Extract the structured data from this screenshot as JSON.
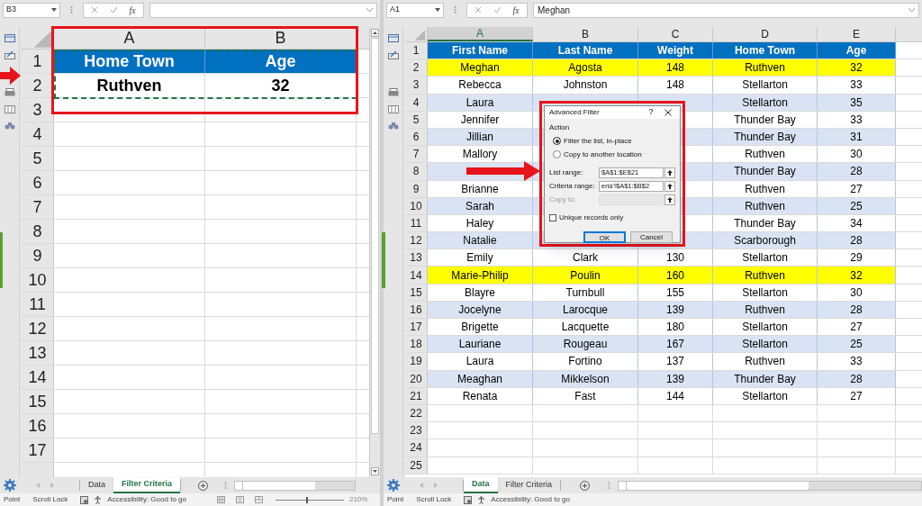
{
  "left_pane": {
    "name_box": "B3",
    "fx_label": "fx",
    "columns": [
      {
        "label": "A",
        "selected": false
      },
      {
        "label": "B",
        "selected": false
      }
    ],
    "row_numbers": [
      "1",
      "2",
      "3",
      "4",
      "5",
      "6",
      "7",
      "8",
      "9",
      "10",
      "11",
      "12",
      "13",
      "14",
      "15",
      "16",
      "17"
    ],
    "rows": [
      {
        "kind": "header",
        "cells": [
          "Home Town",
          "Age"
        ]
      },
      {
        "kind": "value",
        "cells": [
          "Ruthven",
          "32"
        ]
      }
    ],
    "sheet_tabs": [
      {
        "label": "Data",
        "selected": false
      },
      {
        "label": "Filter Criteria",
        "selected": true
      }
    ],
    "status_bar": {
      "mode": "Point",
      "scroll_lock": "Scroll Lock",
      "accessibility": "Accessibility: Good to go",
      "zoom_slider": {
        "level": 0.45
      },
      "zoom": "210%"
    }
  },
  "right_pane": {
    "name_box": "A1",
    "fx_label": "fx",
    "formula": "Meghan",
    "columns": [
      {
        "label": "A",
        "selected": true
      },
      {
        "label": "B",
        "selected": false
      },
      {
        "label": "C",
        "selected": false
      },
      {
        "label": "D",
        "selected": false
      },
      {
        "label": "E",
        "selected": false
      }
    ],
    "rows": [
      {
        "number": "1",
        "kind": "header",
        "color": "#0070c0",
        "cells": [
          "First Name",
          "Last Name",
          "Weight",
          "Home Town",
          "Age"
        ]
      },
      {
        "number": "2",
        "kind": "data",
        "color": "#ffff00",
        "cells": [
          "Meghan",
          "Agosta",
          "148",
          "Ruthven",
          "32"
        ]
      },
      {
        "number": "3",
        "kind": "data",
        "color": "#ffffff",
        "cells": [
          "Rebecca",
          "Johnston",
          "148",
          "Stellarton",
          "33"
        ]
      },
      {
        "number": "4",
        "kind": "data",
        "color": "#dae3f3",
        "cells": [
          "Laura",
          null,
          null,
          "Stellarton",
          "35"
        ]
      },
      {
        "number": "5",
        "kind": "data",
        "color": "#ffffff",
        "cells": [
          "Jennifer",
          null,
          null,
          "Thunder Bay",
          "33"
        ]
      },
      {
        "number": "6",
        "kind": "data",
        "color": "#dae3f3",
        "cells": [
          "Jillian",
          null,
          null,
          "Thunder Bay",
          "31"
        ]
      },
      {
        "number": "7",
        "kind": "data",
        "color": "#ffffff",
        "cells": [
          "Mallory",
          null,
          null,
          "Ruthven",
          "30"
        ]
      },
      {
        "number": "8",
        "kind": "data",
        "color": "#dae3f3",
        "cells": [
          null,
          null,
          null,
          "Thunder Bay",
          "28"
        ]
      },
      {
        "number": "9",
        "kind": "data",
        "color": "#ffffff",
        "cells": [
          "Brianne",
          null,
          null,
          "Ruthven",
          "27"
        ]
      },
      {
        "number": "10",
        "kind": "data",
        "color": "#dae3f3",
        "cells": [
          "Sarah",
          null,
          null,
          "Ruthven",
          "25"
        ]
      },
      {
        "number": "11",
        "kind": "data",
        "color": "#ffffff",
        "cells": [
          "Haley",
          null,
          null,
          "Thunder Bay",
          "34"
        ]
      },
      {
        "number": "12",
        "kind": "data",
        "color": "#dae3f3",
        "cells": [
          "Natalie",
          null,
          null,
          "Scarborough",
          "28"
        ]
      },
      {
        "number": "13",
        "kind": "data",
        "color": "#ffffff",
        "cells": [
          "Emily",
          "Clark",
          "130",
          "Stellarton",
          "29"
        ]
      },
      {
        "number": "14",
        "kind": "data",
        "color": "#ffff00",
        "cells": [
          "Marie-Philip",
          "Poulin",
          "160",
          "Ruthven",
          "32"
        ]
      },
      {
        "number": "15",
        "kind": "data",
        "color": "#ffffff",
        "cells": [
          "Blayre",
          "Turnbull",
          "155",
          "Stellarton",
          "30"
        ]
      },
      {
        "number": "16",
        "kind": "data",
        "color": "#dae3f3",
        "cells": [
          "Jocelyne",
          "Larocque",
          "139",
          "Ruthven",
          "28"
        ]
      },
      {
        "number": "17",
        "kind": "data",
        "color": "#ffffff",
        "cells": [
          "Brigette",
          "Lacquette",
          "180",
          "Stellarton",
          "27"
        ]
      },
      {
        "number": "18",
        "kind": "data",
        "color": "#dae3f3",
        "cells": [
          "Lauriane",
          "Rougeau",
          "167",
          "Stellarton",
          "25"
        ]
      },
      {
        "number": "19",
        "kind": "data",
        "color": "#ffffff",
        "cells": [
          "Laura",
          "Fortino",
          "137",
          "Ruthven",
          "33"
        ]
      },
      {
        "number": "20",
        "kind": "data",
        "color": "#dae3f3",
        "cells": [
          "Meaghan",
          "Mikkelson",
          "139",
          "Thunder Bay",
          "28"
        ]
      },
      {
        "number": "21",
        "kind": "data",
        "color": "#ffffff",
        "cells": [
          "Renata",
          "Fast",
          "144",
          "Stellarton",
          "27"
        ]
      },
      {
        "number": "22",
        "kind": "empty"
      },
      {
        "number": "23",
        "kind": "empty"
      },
      {
        "number": "24",
        "kind": "empty"
      },
      {
        "number": "25",
        "kind": "empty"
      }
    ],
    "sheet_tabs": [
      {
        "label": "Data",
        "selected": true
      },
      {
        "label": "Filter Criteria",
        "selected": false
      }
    ],
    "status_bar": {
      "mode": "Point",
      "scroll_lock": "Scroll Lock",
      "accessibility": "Accessibility: Good to go"
    }
  },
  "dialog": {
    "title": "Advanced Filter",
    "help": "?",
    "group_label": "Action",
    "options": [
      {
        "label": "Filter the list, in-place",
        "selected": true
      },
      {
        "label": "Copy to another location",
        "selected": false
      }
    ],
    "fields": [
      {
        "label": "List range:",
        "value": "$A$1:$E$21",
        "disabled": false
      },
      {
        "label": "Criteria range:",
        "value": "eria'!$A$1:$B$2",
        "disabled": false
      },
      {
        "label": "Copy to:",
        "disabled": true
      }
    ],
    "checkbox": {
      "label": "Unique records only",
      "checked": false
    },
    "buttons": [
      {
        "label": "OK",
        "default": true
      },
      {
        "label": "Cancel",
        "default": false
      }
    ]
  }
}
